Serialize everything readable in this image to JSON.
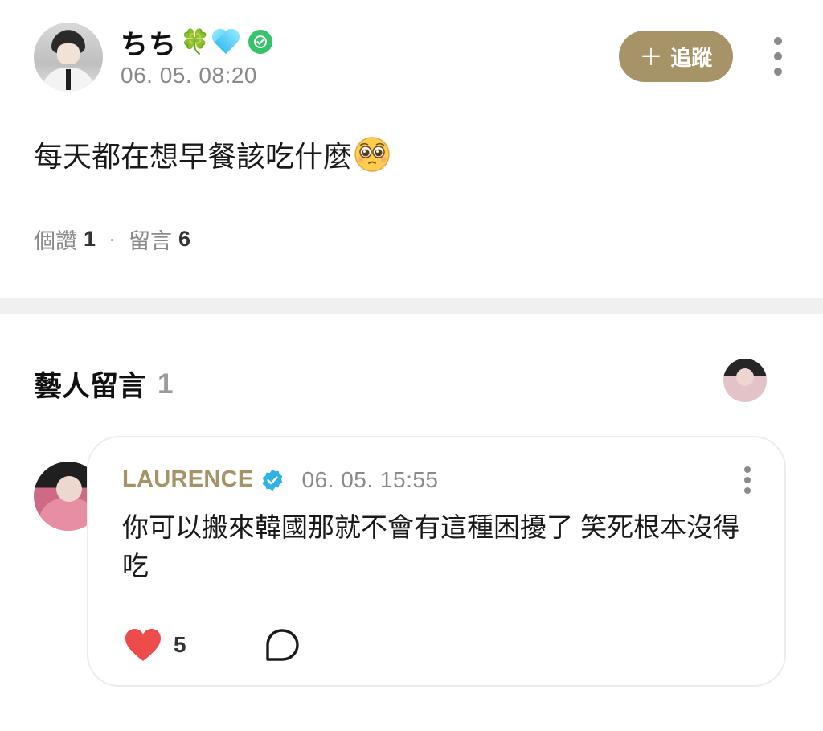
{
  "post": {
    "author": {
      "name": "ちち",
      "badge_emoji": "🍀",
      "heart_icon": "blue-heart-icon",
      "verified_icon": "green-check-badge-icon"
    },
    "timestamp": "06. 05. 08:20",
    "follow_label": "追蹤",
    "follow_icon": "plus-icon",
    "text": "每天都在想早餐該吃什麼",
    "text_emoji": "pleading-face-icon",
    "stats": {
      "likes_label": "個讚",
      "likes_count": "1",
      "separator": "·",
      "comments_label": "留言",
      "comments_count": "6"
    }
  },
  "artist_comments": {
    "title": "藝人留言",
    "count": "1",
    "comments": [
      {
        "author": "LAURENCE",
        "verified_icon": "blue-verified-badge-icon",
        "time": "06. 05. 15:55",
        "text": "你可以搬來韓國那就不會有這種困擾了 笑死根本沒得吃",
        "like_count": "5"
      }
    ]
  },
  "colors": {
    "accent_gold": "#a69368",
    "muted_text": "#8a8a8a",
    "like_red": "#ee4b4b",
    "verified_blue": "#2fb3e6",
    "verified_green": "#36c46a",
    "divider": "#f0f0f0"
  }
}
